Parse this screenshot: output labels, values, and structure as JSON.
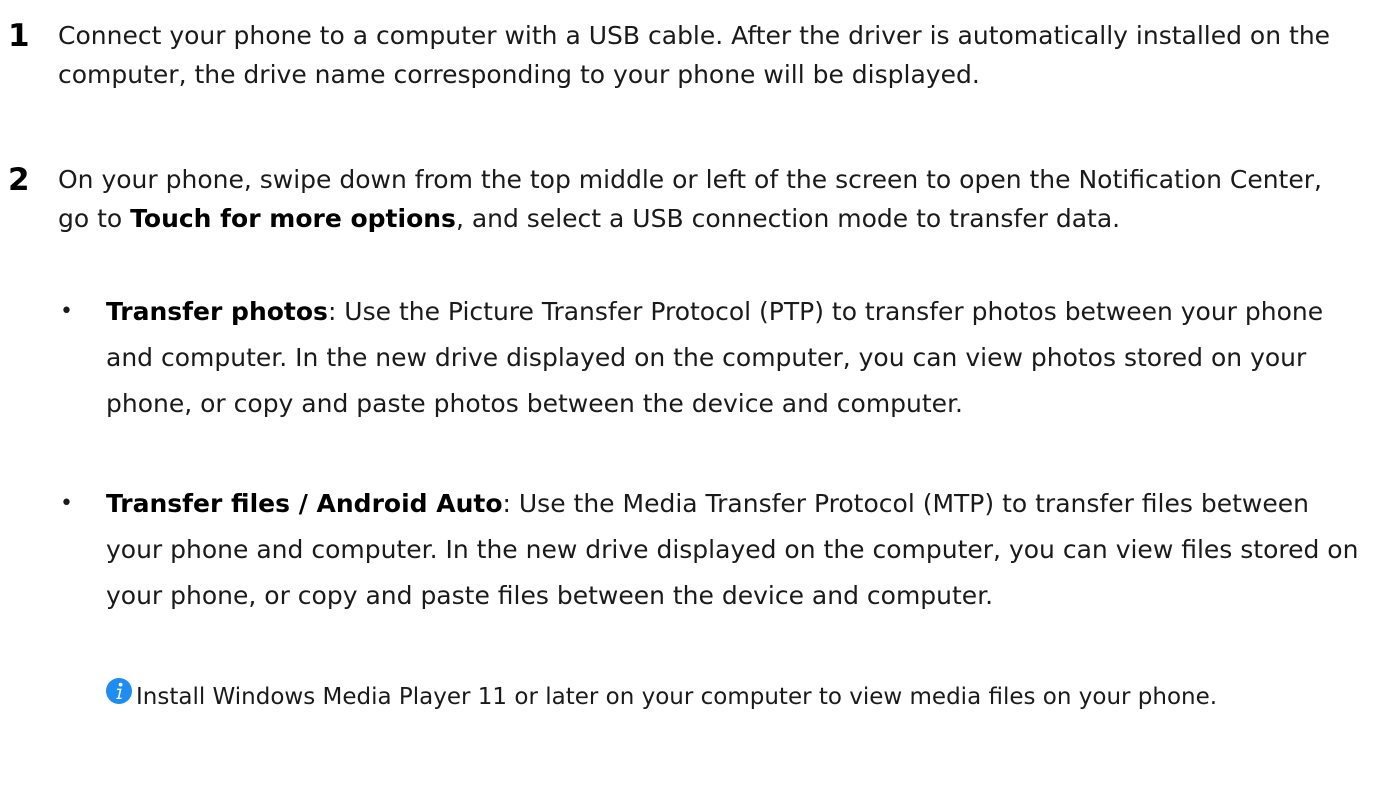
{
  "steps": [
    {
      "number": "1",
      "text": "Connect your phone to a computer with a USB cable. After the driver is automatically installed on the computer, the drive name corresponding to your phone will be displayed."
    },
    {
      "number": "2",
      "text_before": "On your phone, swipe down from the top middle or left of the screen to open the Notification Center, go to ",
      "text_bold": "Touch for more options",
      "text_after": ", and select a USB connection mode to transfer data."
    }
  ],
  "bullets": [
    {
      "marker": "•",
      "title": "Transfer photos",
      "text": ": Use the Picture Transfer Protocol (PTP) to transfer photos between your phone and computer. In the new drive displayed on the computer, you can view photos stored on your phone, or copy and paste photos between the device and computer."
    },
    {
      "marker": "•",
      "title": "Transfer files / Android Auto",
      "text": ": Use the Media Transfer Protocol (MTP) to transfer files between your phone and computer. In the new drive displayed on the computer, you can view files stored on your phone, or copy and paste files between the device and computer."
    }
  ],
  "note": {
    "icon": "info-icon",
    "icon_color": "#1e8cf0",
    "text": "Install Windows Media Player 11 or later on your computer to view media files on your phone."
  }
}
